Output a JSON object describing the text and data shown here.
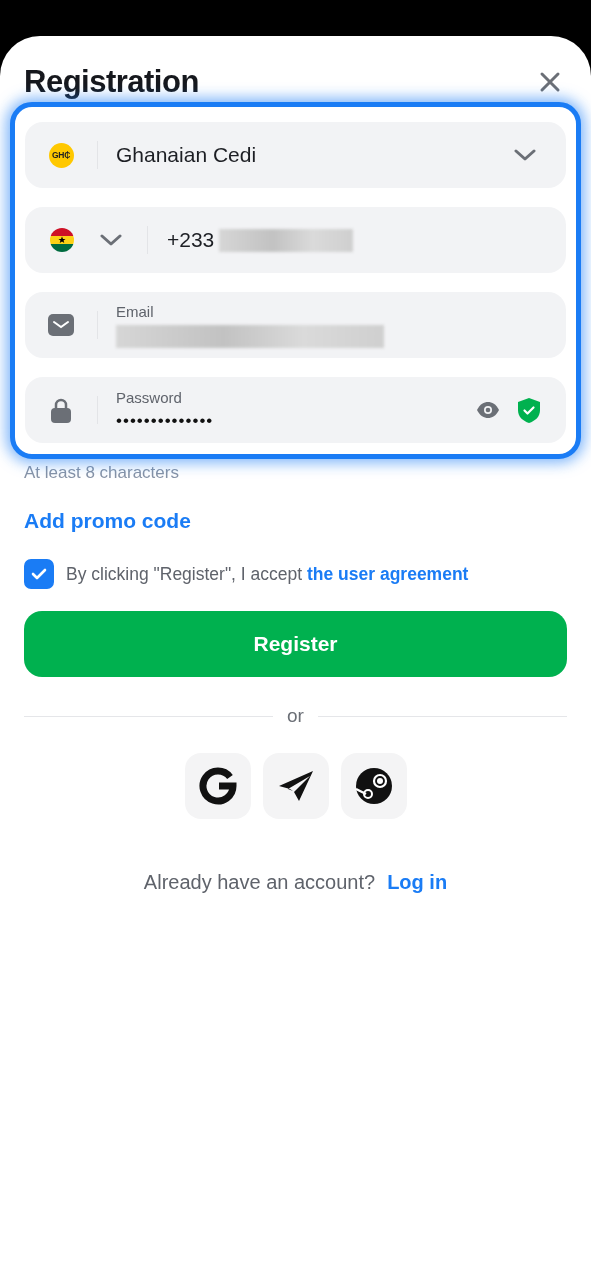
{
  "title": "Registration",
  "currency": {
    "badge": "GH₵",
    "value": "Ghanaian Cedi"
  },
  "phone": {
    "code": "+233"
  },
  "email": {
    "label": "Email"
  },
  "password": {
    "label": "Password",
    "value": "••••••••••••••",
    "verified": true
  },
  "hint": "At least 8 characters",
  "promo_link": "Add promo code",
  "agreement": {
    "checked": true,
    "text": "By clicking \"Register\", I accept",
    "link": "the user agreement"
  },
  "register_button": "Register",
  "divider": "or",
  "social": [
    {
      "kind": "google"
    },
    {
      "kind": "telegram"
    },
    {
      "kind": "steam"
    }
  ],
  "login": {
    "text": "Already have an account?",
    "link": "Log in"
  }
}
